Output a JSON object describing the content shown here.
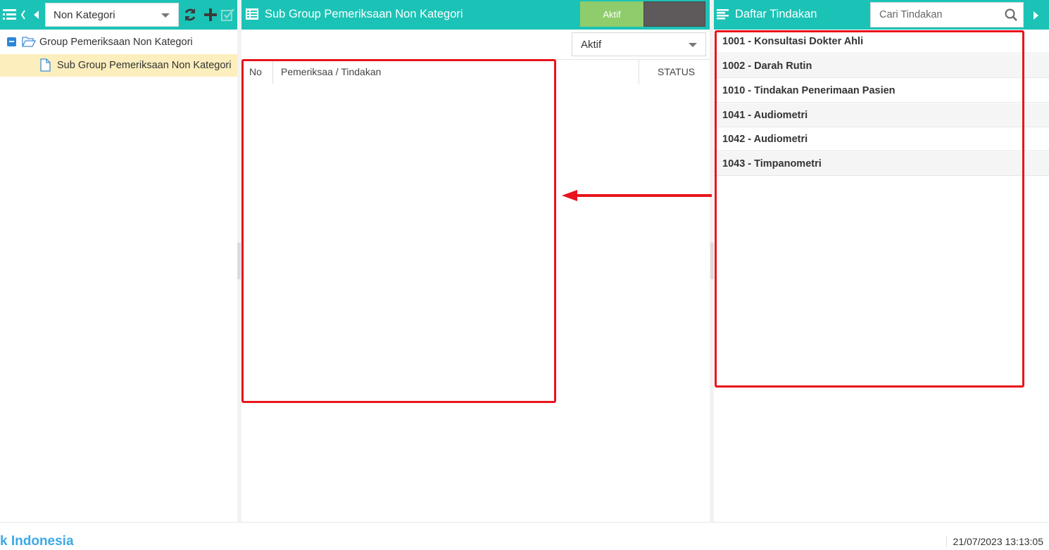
{
  "left": {
    "category_select": "Non Kategori",
    "tree": [
      {
        "label": "Group Pemeriksaan Non Kategori"
      },
      {
        "label": "Sub Group Pemeriksaan Non Kategori"
      }
    ]
  },
  "middle": {
    "title": "Sub Group Pemeriksaan Non Kategori",
    "toggle": {
      "on_label": "Aktif"
    },
    "status_filter": "Aktif",
    "columns": {
      "no": "No",
      "name": "Pemeriksaa / Tindakan",
      "status": "STATUS"
    }
  },
  "right": {
    "title": "Daftar Tindakan",
    "search_placeholder": "Cari Tindakan",
    "items": [
      "1001 - Konsultasi Dokter Ahli",
      "1002 - Darah Rutin",
      "1010 - Tindakan Penerimaan Pasien",
      "1041 - Audiometri",
      "1042 - Audiometri",
      "1043 - Timpanometri"
    ]
  },
  "footer": {
    "brand": "k Indonesia",
    "datetime": "21/07/2023 13:13:05"
  },
  "colors": {
    "header": "#1bc3b6",
    "toggle_on": "#8fcc6b",
    "toggle_off": "#5e5a5b",
    "selected_row": "#fceebd",
    "annotation": "#e8141c",
    "brand": "#3ba9e6"
  },
  "icons": [
    "list-menu-icon",
    "collapse-left-icon",
    "prev-icon",
    "refresh-icon",
    "plus-icon",
    "edit-check-icon",
    "tree-collapse-icon",
    "folder-open-icon",
    "file-icon",
    "list-icon",
    "search-icon",
    "next-icon",
    "arrow-left-icon"
  ]
}
